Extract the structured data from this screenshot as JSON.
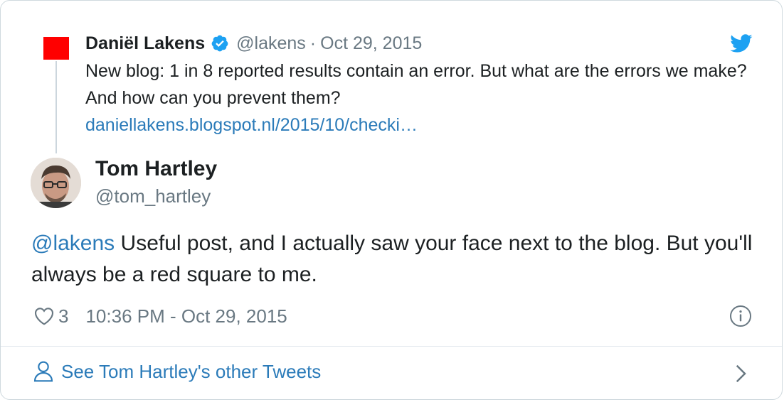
{
  "parent_tweet": {
    "name": "Daniël Lakens",
    "handle": "@lakens",
    "separator": "·",
    "date": "Oct 29, 2015",
    "text": "New blog: 1 in 8 reported results contain an error. But what are the errors we make? And how can you prevent them?",
    "link": "daniellakens.blogspot.nl/2015/10/checki…",
    "avatar_color": "#ff0000"
  },
  "tweet": {
    "author_name": "Tom Hartley",
    "author_handle": "@tom_hartley",
    "mention": "@lakens",
    "text": " Useful post, and I actually saw your face next to the blog. But you'll always be a red square to me.",
    "like_count": "3",
    "timestamp": "10:36 PM - Oct 29, 2015"
  },
  "footer": {
    "other_tweets_label": "See Tom Hartley's other Tweets"
  },
  "icons": {
    "verified": "verified-badge-icon",
    "twitter": "twitter-bird-icon",
    "like": "heart-icon",
    "info": "info-icon",
    "person": "person-icon",
    "chevron": "chevron-right-icon"
  },
  "colors": {
    "link": "#2b7bb9",
    "twitter_blue": "#1da1f2",
    "secondary_text": "#697882"
  }
}
